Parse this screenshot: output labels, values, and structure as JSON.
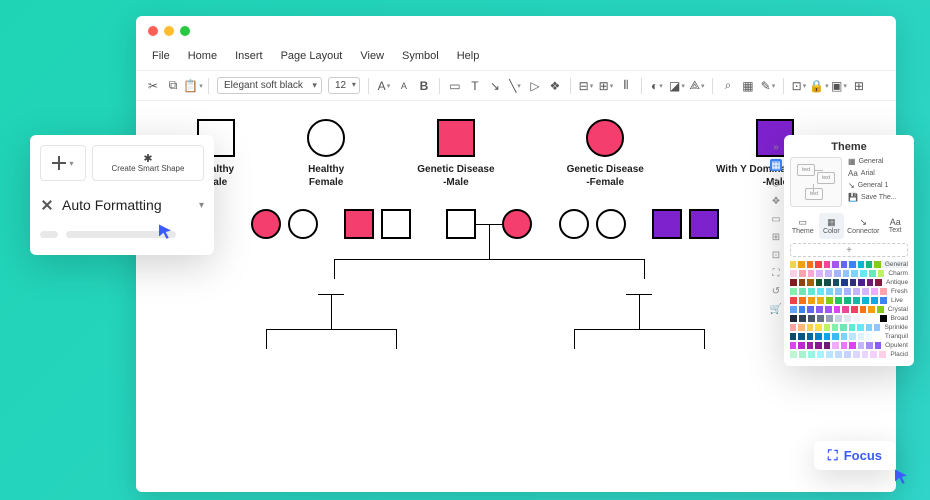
{
  "menubar": [
    "File",
    "Home",
    "Insert",
    "Page Layout",
    "View",
    "Symbol",
    "Help"
  ],
  "toolbar": {
    "font": "Elegant soft black",
    "size": "12"
  },
  "legend": [
    {
      "label": "Healthy\nMale"
    },
    {
      "label": "Healthy\nFemale"
    },
    {
      "label": "Genetic Disease\n-Male"
    },
    {
      "label": "Genetic Disease\n-Female"
    },
    {
      "label": "With Y Dominant Genetic\n-Male"
    }
  ],
  "autofmt": {
    "smart": "Create Smart Shape",
    "main": "Auto Formatting"
  },
  "theme": {
    "title": "Theme",
    "side": [
      "General",
      "Arial",
      "General 1",
      "Save The..."
    ],
    "tabs": [
      "Theme",
      "Color",
      "Connector",
      "Text"
    ],
    "palettes": [
      "General",
      "Charm",
      "Antique",
      "Fresh",
      "Live",
      "Crystal",
      "Broad",
      "Sprinkle",
      "Tranquil",
      "Opulent",
      "Placid"
    ]
  },
  "focus": "Focus",
  "colors": {
    "pink": "#f43f6e",
    "purple": "#7e22ce",
    "swatches": [
      [
        "#f0d54a",
        "#f59e0b",
        "#f97316",
        "#ef4444",
        "#ec4899",
        "#a855f7",
        "#6366f1",
        "#3b82f6",
        "#06b6d4",
        "#10b981",
        "#84cc16"
      ],
      [
        "#fbcfe8",
        "#fda4af",
        "#f9a8d4",
        "#d8b4fe",
        "#c4b5fd",
        "#a5b4fc",
        "#93c5fd",
        "#7dd3fc",
        "#67e8f9",
        "#6ee7b7",
        "#bef264"
      ],
      [
        "#7f1d1d",
        "#92400e",
        "#a16207",
        "#14532d",
        "#134e4a",
        "#164e63",
        "#1e3a8a",
        "#312e81",
        "#4c1d95",
        "#701a75",
        "#831843"
      ],
      [
        "#86efac",
        "#6ee7b7",
        "#5eead4",
        "#67e8f9",
        "#7dd3fc",
        "#93c5fd",
        "#a5b4fc",
        "#c4b5fd",
        "#d8b4fe",
        "#f0abfc",
        "#fda4af"
      ],
      [
        "#ef4444",
        "#f97316",
        "#f59e0b",
        "#eab308",
        "#84cc16",
        "#22c55e",
        "#10b981",
        "#14b8a6",
        "#06b6d4",
        "#0ea5e9",
        "#3b82f6"
      ],
      [
        "#60a5fa",
        "#3b82f6",
        "#6366f1",
        "#8b5cf6",
        "#a855f7",
        "#d946ef",
        "#ec4899",
        "#f43f5e",
        "#f97316",
        "#f59e0b",
        "#84cc16"
      ],
      [
        "#1e293b",
        "#334155",
        "#475569",
        "#64748b",
        "#94a3b8",
        "#cbd5e1",
        "#e2e8f0",
        "#f1f5f9",
        "#f8fafc",
        "#fff",
        "#000"
      ],
      [
        "#fca5a5",
        "#fdba74",
        "#fcd34d",
        "#fde047",
        "#bef264",
        "#86efac",
        "#6ee7b7",
        "#5eead4",
        "#67e8f9",
        "#7dd3fc",
        "#93c5fd"
      ],
      [
        "#0c4a6e",
        "#075985",
        "#0369a1",
        "#0284c7",
        "#0ea5e9",
        "#38bdf8",
        "#7dd3fc",
        "#bae6fd",
        "#e0f2fe",
        "#f0f9ff",
        "#fff"
      ],
      [
        "#d946ef",
        "#c026d3",
        "#a21caf",
        "#86198f",
        "#701a75",
        "#f0abfc",
        "#e879f9",
        "#d946ef",
        "#c4b5fd",
        "#a78bfa",
        "#8b5cf6"
      ],
      [
        "#bbf7d0",
        "#a7f3d0",
        "#99f6e4",
        "#a5f3fc",
        "#bae6fd",
        "#bfdbfe",
        "#c7d2fe",
        "#ddd6fe",
        "#e9d5ff",
        "#f5d0fe",
        "#fbcfe8"
      ]
    ]
  }
}
